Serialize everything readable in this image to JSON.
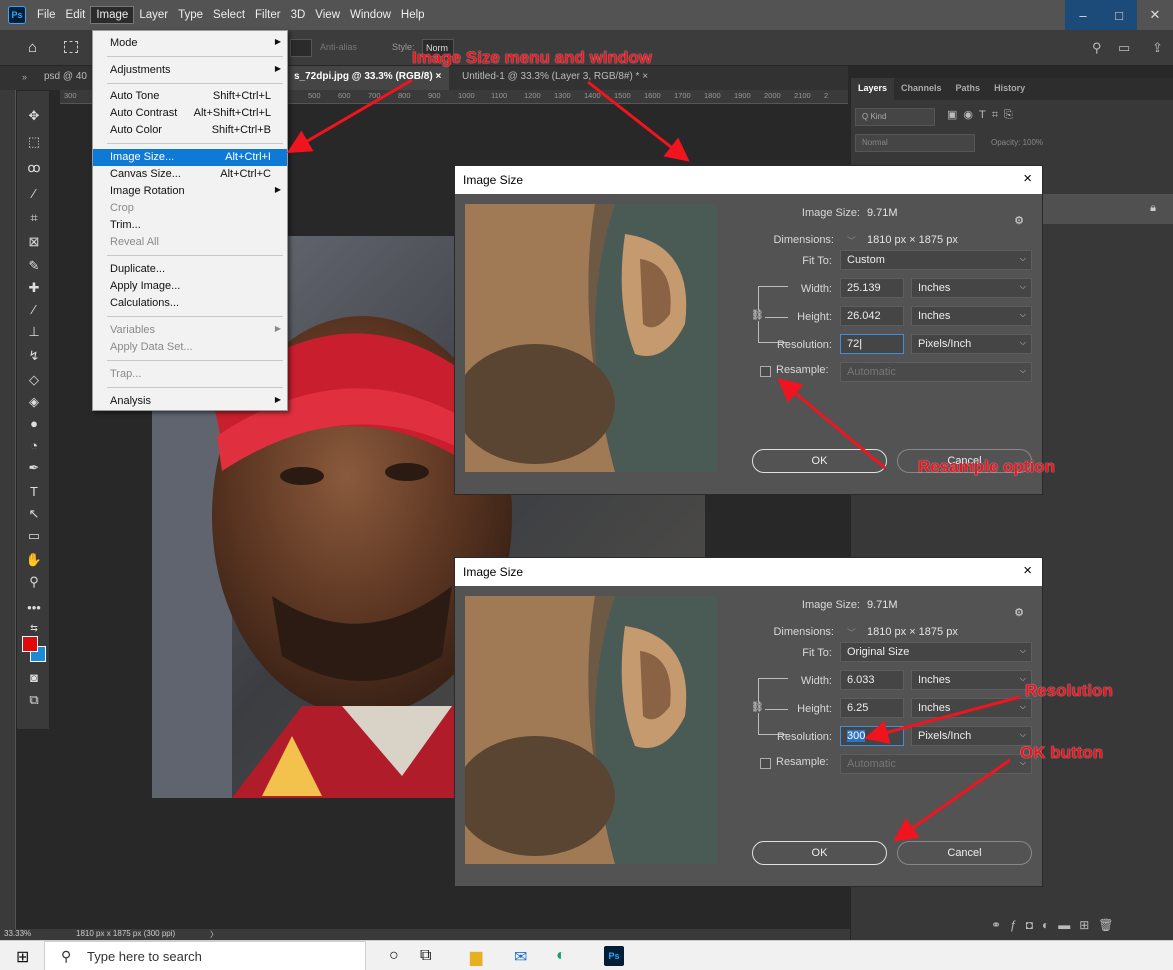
{
  "menubar": {
    "app_icon": "Ps",
    "items": [
      "File",
      "Edit",
      "Image",
      "Layer",
      "Type",
      "Select",
      "Filter",
      "3D",
      "View",
      "Window",
      "Help"
    ]
  },
  "options_bar": {
    "anti_alias": "Anti-alias",
    "style_label": "Style:",
    "style_value": "Norm"
  },
  "tabs": [
    {
      "label": "psd @ 40"
    },
    {
      "label": "s_72dpi.jpg @ 33.3% (RGB/8)",
      "close": "×"
    },
    {
      "label": "Untitled-1 @ 33.3% (Layer 3, RGB/8#) *",
      "close": "×"
    }
  ],
  "ruler_ticks": [
    "300",
    "500",
    "600",
    "700",
    "800",
    "900",
    "1000",
    "1100",
    "1200",
    "1300",
    "1400",
    "1500",
    "1600",
    "1700",
    "1800",
    "1900",
    "2000",
    "2100",
    "2"
  ],
  "image_menu": {
    "items": [
      {
        "label": "Mode",
        "shortcut": "",
        "submenu": true
      },
      {
        "label": "Adjustments",
        "shortcut": "",
        "submenu": true
      },
      {
        "label": "Auto Tone",
        "shortcut": "Shift+Ctrl+L"
      },
      {
        "label": "Auto Contrast",
        "shortcut": "Alt+Shift+Ctrl+L"
      },
      {
        "label": "Auto Color",
        "shortcut": "Shift+Ctrl+B"
      },
      {
        "label": "Image Size...",
        "shortcut": "Alt+Ctrl+I"
      },
      {
        "label": "Canvas Size...",
        "shortcut": "Alt+Ctrl+C"
      },
      {
        "label": "Image Rotation",
        "shortcut": "",
        "submenu": true
      },
      {
        "label": "Crop",
        "shortcut": ""
      },
      {
        "label": "Trim...",
        "shortcut": ""
      },
      {
        "label": "Reveal All",
        "shortcut": ""
      },
      {
        "label": "Duplicate...",
        "shortcut": ""
      },
      {
        "label": "Apply Image...",
        "shortcut": ""
      },
      {
        "label": "Calculations...",
        "shortcut": ""
      },
      {
        "label": "Variables",
        "shortcut": "",
        "submenu": true
      },
      {
        "label": "Apply Data Set...",
        "shortcut": ""
      },
      {
        "label": "Trap...",
        "shortcut": ""
      },
      {
        "label": "Analysis",
        "shortcut": "",
        "submenu": true
      }
    ],
    "highlighted": "Image Size..."
  },
  "dialog1": {
    "title": "Image Size",
    "close": "×",
    "image_size_label": "Image Size:",
    "image_size_value": "9.71M",
    "dimensions_label": "Dimensions:",
    "dimensions_value": "1810 px × 1875 px",
    "fit_to_label": "Fit To:",
    "fit_to_value": "Custom",
    "width_label": "Width:",
    "width_value": "25.139",
    "width_unit": "Inches",
    "height_label": "Height:",
    "height_value": "26.042",
    "height_unit": "Inches",
    "resolution_label": "Resolution:",
    "resolution_value": "72",
    "resolution_unit": "Pixels/Inch",
    "resample_label": "Resample:",
    "resample_value": "Automatic",
    "ok": "OK",
    "cancel": "Cancel"
  },
  "dialog2": {
    "title": "Image Size",
    "close": "×",
    "image_size_label": "Image Size:",
    "image_size_value": "9.71M",
    "dimensions_label": "Dimensions:",
    "dimensions_value": "1810 px × 1875 px",
    "fit_to_label": "Fit To:",
    "fit_to_value": "Original Size",
    "width_label": "Width:",
    "width_value": "6.033",
    "width_unit": "Inches",
    "height_label": "Height:",
    "height_value": "6.25",
    "height_unit": "Inches",
    "resolution_label": "Resolution:",
    "resolution_value": "300",
    "resolution_unit": "Pixels/Inch",
    "resample_label": "Resample:",
    "resample_value": "Automatic",
    "ok": "OK",
    "cancel": "Cancel"
  },
  "layers_panel": {
    "tabs": [
      "Layers",
      "Channels",
      "Paths",
      "History"
    ],
    "kind": "Q Kind",
    "blend": "Normal",
    "opacity": "Opacity: 100%"
  },
  "status": {
    "zoom": "33.33%",
    "doc_info": "1810 px x 1875 px (300 ppi)"
  },
  "annotations": {
    "menu_window": "Image Size menu and window",
    "resample": "Resample option",
    "resolution": "Resolution",
    "ok_button": "OK button",
    "color": "#f0141e"
  },
  "taskbar": {
    "search_placeholder": "Type here to search"
  }
}
